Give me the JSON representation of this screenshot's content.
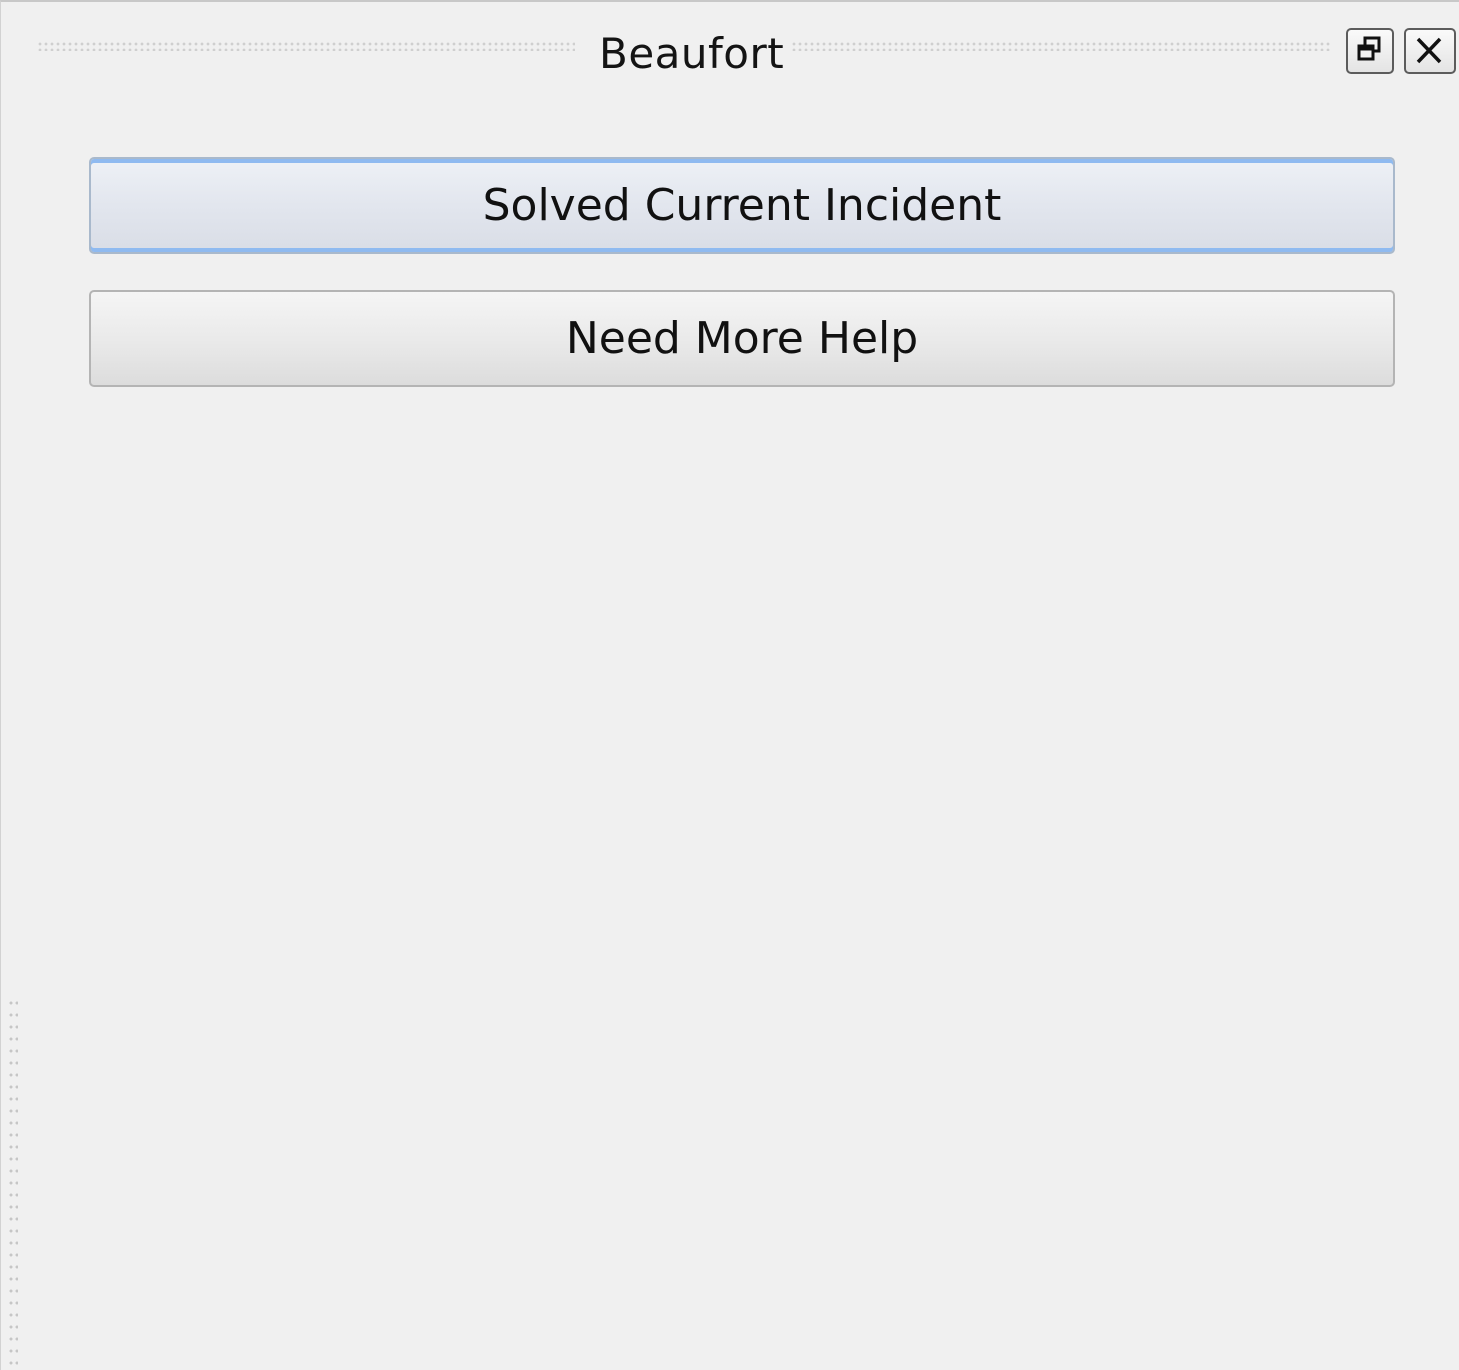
{
  "window": {
    "title": "Beaufort",
    "float_icon": "float-restore-icon",
    "close_icon": "close-icon"
  },
  "actions": {
    "solved_label": "Solved Current Incident",
    "help_label": "Need More Help"
  },
  "colors": {
    "background": "#f0f0f0",
    "focus_accent": "#8fbaf0",
    "text": "#111111"
  }
}
